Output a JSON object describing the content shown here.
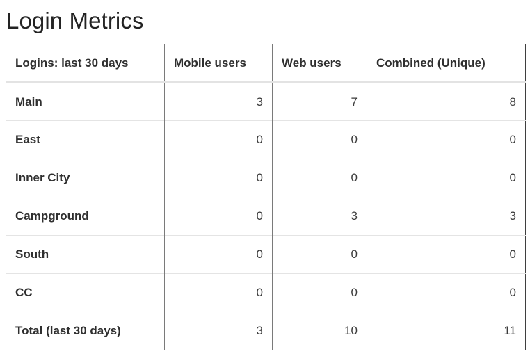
{
  "page": {
    "title": "Login Metrics"
  },
  "table": {
    "headers": [
      "Logins: last 30 days",
      "Mobile users",
      "Web users",
      "Combined (Unique)"
    ],
    "rows": [
      {
        "label": "Main",
        "mobile": "3",
        "web": "7",
        "combined": "8"
      },
      {
        "label": "East",
        "mobile": "0",
        "web": "0",
        "combined": "0"
      },
      {
        "label": "Inner City",
        "mobile": "0",
        "web": "0",
        "combined": "0"
      },
      {
        "label": "Campground",
        "mobile": "0",
        "web": "3",
        "combined": "3"
      },
      {
        "label": "South",
        "mobile": "0",
        "web": "0",
        "combined": "0"
      },
      {
        "label": "CC",
        "mobile": "0",
        "web": "0",
        "combined": "0"
      },
      {
        "label": "Total (last 30 days)",
        "mobile": "3",
        "web": "10",
        "combined": "11"
      }
    ]
  },
  "chart_data": {
    "type": "table",
    "title": "Login Metrics",
    "columns": [
      "Logins: last 30 days",
      "Mobile users",
      "Web users",
      "Combined (Unique)"
    ],
    "categories": [
      "Main",
      "East",
      "Inner City",
      "Campground",
      "South",
      "CC",
      "Total (last 30 days)"
    ],
    "series": [
      {
        "name": "Mobile users",
        "values": [
          3,
          0,
          0,
          0,
          0,
          0,
          3
        ]
      },
      {
        "name": "Web users",
        "values": [
          7,
          0,
          0,
          3,
          0,
          0,
          10
        ]
      },
      {
        "name": "Combined (Unique)",
        "values": [
          8,
          0,
          0,
          3,
          0,
          0,
          11
        ]
      }
    ],
    "xlabel": "",
    "ylabel": "",
    "grid": true,
    "legend": "none"
  },
  "colors": {
    "text": "#2b2b2b",
    "heading": "#232323",
    "outer_border": "#3f3f3f",
    "column_divider": "#7a7a7a",
    "row_divider": "#e4e4e4",
    "header_rule": "#e3e3e3",
    "background": "#ffffff"
  }
}
